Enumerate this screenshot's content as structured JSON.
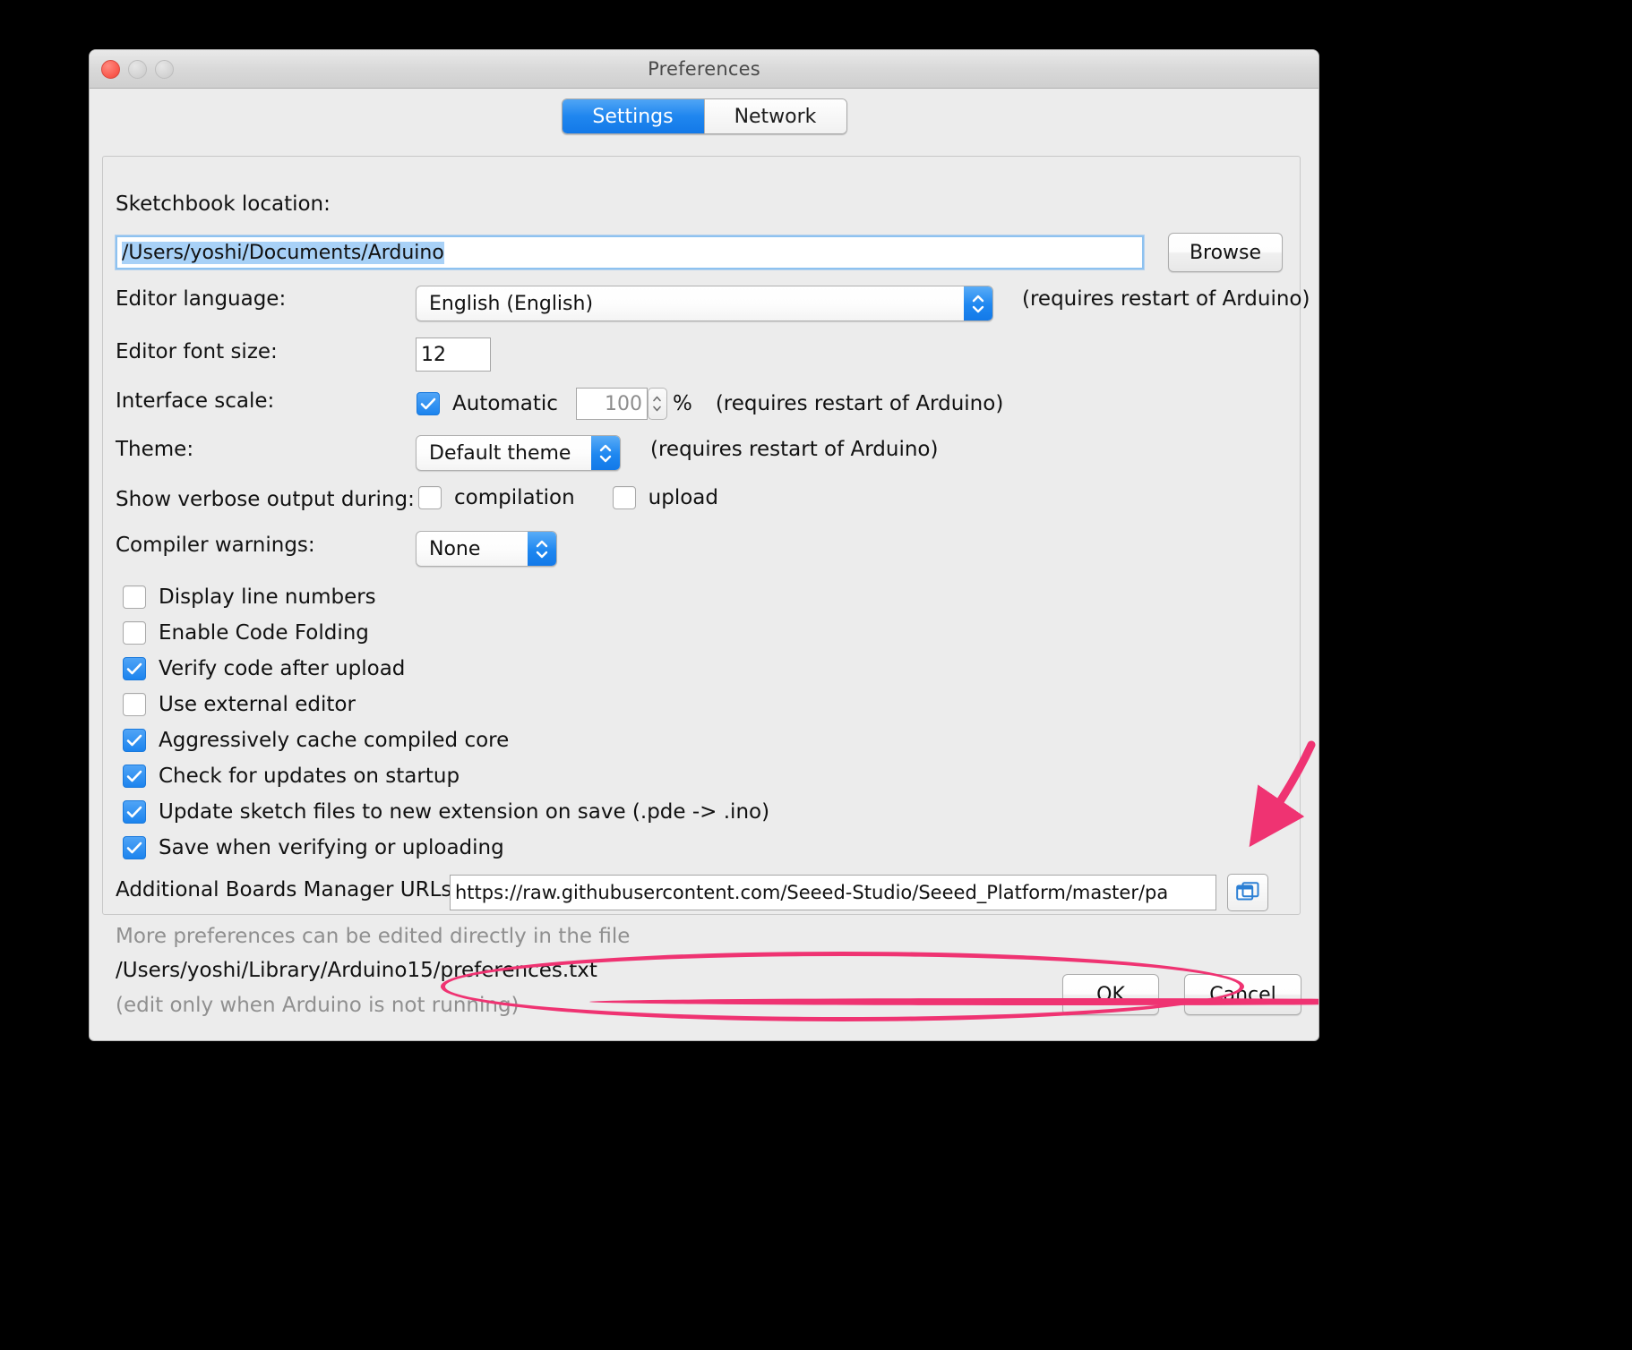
{
  "window": {
    "title": "Preferences",
    "traffic_lights": [
      "close-button",
      "minimize-button",
      "zoom-button"
    ]
  },
  "tabs": [
    {
      "label": "Settings",
      "active": true
    },
    {
      "label": "Network",
      "active": false
    }
  ],
  "settings": {
    "sketchbook": {
      "label": "Sketchbook location:",
      "value": "/Users/yoshi/Documents/Arduino",
      "browse_label": "Browse"
    },
    "editor_language": {
      "label": "Editor language:",
      "value": "English (English)",
      "note": "(requires restart of Arduino)"
    },
    "editor_font_size": {
      "label": "Editor font size:",
      "value": "12"
    },
    "interface_scale": {
      "label": "Interface scale:",
      "automatic_label": "Automatic",
      "automatic_checked": true,
      "value": "100",
      "unit": "%",
      "note": "(requires restart of Arduino)"
    },
    "theme": {
      "label": "Theme:",
      "value": "Default theme",
      "note": "(requires restart of Arduino)"
    },
    "verbose": {
      "label": "Show verbose output during:",
      "compilation_label": "compilation",
      "compilation_checked": false,
      "upload_label": "upload",
      "upload_checked": false
    },
    "compiler_warnings": {
      "label": "Compiler warnings:",
      "value": "None"
    },
    "checkboxes": [
      {
        "label": "Display line numbers",
        "checked": false
      },
      {
        "label": "Enable Code Folding",
        "checked": false
      },
      {
        "label": "Verify code after upload",
        "checked": true
      },
      {
        "label": "Use external editor",
        "checked": false
      },
      {
        "label": "Aggressively cache compiled core",
        "checked": true
      },
      {
        "label": "Check for updates on startup",
        "checked": true
      },
      {
        "label": "Update sketch files to new extension on save (.pde -> .ino)",
        "checked": true
      },
      {
        "label": "Save when verifying or uploading",
        "checked": true
      }
    ],
    "boards_urls": {
      "label": "Additional Boards Manager URLs:",
      "value": "https://raw.githubusercontent.com/Seeed-Studio/Seeed_Platform/master/pa"
    },
    "more_prefs": {
      "line1": "More preferences can be edited directly in the file",
      "line2": "/Users/yoshi/Library/Arduino15/preferences.txt",
      "line3": "(edit only when Arduino is not running)"
    }
  },
  "footer": {
    "ok_label": "OK",
    "cancel_label": "Cancel"
  },
  "annotation": {
    "color": "#ef3372",
    "target": "boards-manager-urls-edit-button"
  }
}
